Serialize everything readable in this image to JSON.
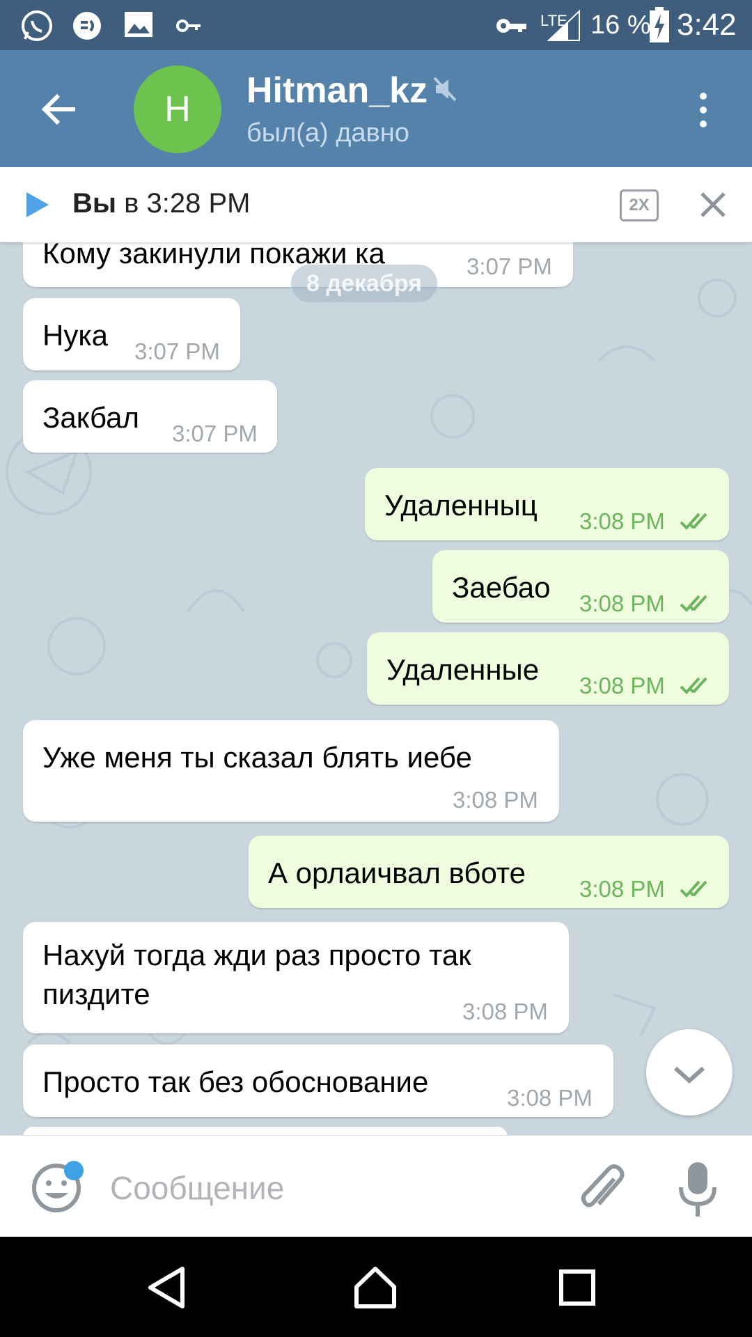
{
  "status_bar": {
    "network": "LTE",
    "battery_percent": "16 %",
    "time": "3:42",
    "icons": [
      "whatsapp-icon",
      "messenger-icon",
      "gallery-icon",
      "key-icon",
      "vpn-key-icon",
      "signal-icon",
      "battery-charging-icon"
    ]
  },
  "header": {
    "avatar_letter": "H",
    "title": "Hitman_kz",
    "status": "был(а) давно",
    "avatar_color": "#6cc44f",
    "header_color": "#5482ab"
  },
  "player": {
    "author": "Вы",
    "time_text": "в 3:28 PM",
    "speed": "2X"
  },
  "date_pill": "8 декабря",
  "messages": [
    {
      "dir": "in",
      "text": "Кому закинули покажи ка",
      "time": "3:07 PM"
    },
    {
      "dir": "in",
      "text": "Нука",
      "time": "3:07 PM"
    },
    {
      "dir": "in",
      "text": "Закбал",
      "time": "3:07 PM"
    },
    {
      "dir": "out",
      "text": "Удаленныц",
      "time": "3:08 PM"
    },
    {
      "dir": "out",
      "text": "Заебао",
      "time": "3:08 PM"
    },
    {
      "dir": "out",
      "text": "Удаленные",
      "time": "3:08 PM"
    },
    {
      "dir": "in",
      "text": "Уже меня ты сказал блять иебе",
      "time": "3:08 PM"
    },
    {
      "dir": "out",
      "text": "А орлаичвал вботе",
      "time": "3:08 PM"
    },
    {
      "dir": "in",
      "text_line1": "Нахуй тогда жди раз просто так",
      "text_line2": "пиздите",
      "time": "3:08 PM"
    },
    {
      "dir": "in",
      "text": "Просто так без обоснование",
      "time": "3:08 PM"
    }
  ],
  "input": {
    "placeholder": "Сообщение",
    "value": ""
  },
  "colors": {
    "outgoing_bubble": "#effdde",
    "incoming_bubble": "#ffffff",
    "read_check": "#6cb45e",
    "chat_background": "#c9d6de"
  }
}
